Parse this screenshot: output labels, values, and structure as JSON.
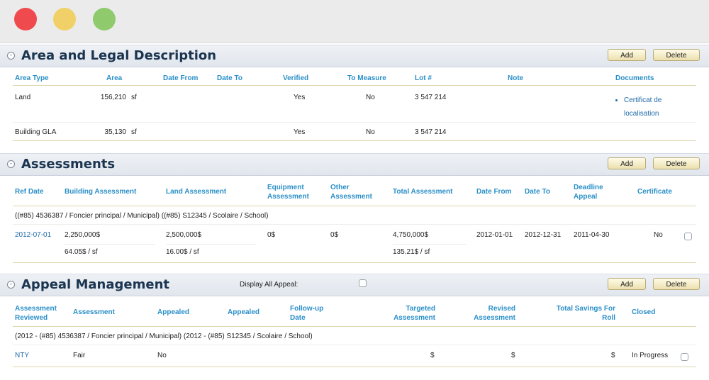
{
  "area_section": {
    "title": "Area and Legal Description",
    "add_label": "Add",
    "delete_label": "Delete",
    "columns": [
      "Area Type",
      "Area",
      "Date From",
      "Date To",
      "Verified",
      "To Measure",
      "Lot #",
      "Note",
      "Documents"
    ],
    "rows": [
      {
        "area_type": "Land",
        "area": "156,210",
        "unit": "sf",
        "verified": "Yes",
        "to_measure": "No",
        "lot": "3 547 214",
        "documents": [
          "Certificat de localisation"
        ]
      },
      {
        "area_type": "Building GLA",
        "area": "35,130",
        "unit": "sf",
        "verified": "Yes",
        "to_measure": "No",
        "lot": "3 547 214"
      }
    ]
  },
  "assessments_section": {
    "title": "Assessments",
    "add_label": "Add",
    "delete_label": "Delete",
    "columns": {
      "ref_date": "Ref Date",
      "building": "Building Assessment",
      "land": "Land Assessment",
      "equipment": "Equipment Assessment",
      "other": "Other Assessment",
      "total": "Total Assessment",
      "date_from": "Date From",
      "date_to": "Date To",
      "deadline": "Deadline Appeal",
      "certificate": "Certificate"
    },
    "group_label": "((#85) 4536387 / Foncier principal / Municipal) ((#85) S12345 / Scolaire / School)",
    "row": {
      "ref_date": "2012-07-01",
      "building": "2,250,000$",
      "building_per_sf": "64.05$ / sf",
      "land": "2,500,000$",
      "land_per_sf": "16.00$ / sf",
      "equipment": "0$",
      "other": "0$",
      "total": "4,750,000$",
      "total_per_sf": "135.21$ / sf",
      "date_from": "2012-01-01",
      "date_to": "2012-12-31",
      "deadline": "2011-04-30",
      "certificate": "No"
    }
  },
  "appeal_section": {
    "title": "Appeal Management",
    "display_all_label": "Display All Appeal:",
    "add_label": "Add",
    "delete_label": "Delete",
    "columns": {
      "assessment_reviewed": "Assessment Reviewed",
      "assessment": "Assessment",
      "appealed_1": "Appealed",
      "appealed_2": "Appealed",
      "follow_up": "Follow-up Date",
      "targeted": "Targeted Assessment",
      "revised": "Revised Assessment",
      "total_savings": "Total Savings For Roll",
      "closed": "Closed"
    },
    "group_label": "(2012 - (#85) 4536387 / Foncier principal / Municipal) (2012 - (#85) S12345 / Scolaire / School)",
    "row": {
      "assessment_reviewed": "NTY",
      "assessment": "Fair",
      "appealed": "No",
      "targeted": "$",
      "revised": "$",
      "total_savings": "$",
      "closed": "In Progress"
    }
  }
}
